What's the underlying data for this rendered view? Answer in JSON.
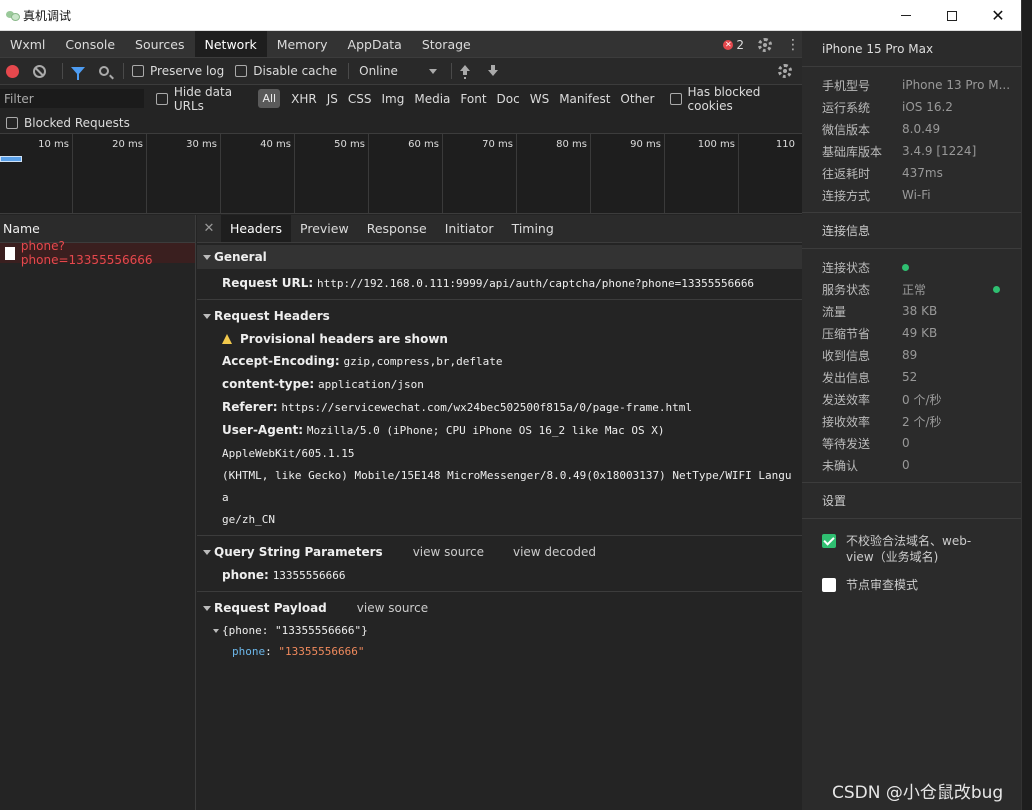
{
  "window": {
    "title": "真机调试"
  },
  "main_tabs": [
    "Wxml",
    "Console",
    "Sources",
    "Network",
    "Memory",
    "AppData",
    "Storage"
  ],
  "error_count": "2",
  "toolbar": {
    "preserve_log": "Preserve log",
    "disable_cache": "Disable cache",
    "throttle": "Online"
  },
  "filterbar": {
    "placeholder": "Filter",
    "hide_data_urls": "Hide data URLs",
    "types": [
      "All",
      "XHR",
      "JS",
      "CSS",
      "Img",
      "Media",
      "Font",
      "Doc",
      "WS",
      "Manifest",
      "Other"
    ],
    "has_blocked_cookies": "Has blocked cookies",
    "blocked_requests": "Blocked Requests"
  },
  "timeline": {
    "ticks": [
      "10 ms",
      "20 ms",
      "30 ms",
      "40 ms",
      "50 ms",
      "60 ms",
      "70 ms",
      "80 ms",
      "90 ms",
      "100 ms",
      "110"
    ]
  },
  "request_list": {
    "header": "Name",
    "items": [
      {
        "name": "phone?phone=13355556666"
      }
    ]
  },
  "detail": {
    "tabs": [
      "Headers",
      "Preview",
      "Response",
      "Initiator",
      "Timing"
    ],
    "general": {
      "title": "General",
      "request_url_label": "Request URL:",
      "request_url": "http://192.168.0.111:9999/api/auth/captcha/phone?phone=13355556666"
    },
    "request_headers": {
      "title": "Request Headers",
      "warning": "Provisional headers are shown",
      "accept_encoding_label": "Accept-Encoding:",
      "accept_encoding": "gzip,compress,br,deflate",
      "content_type_label": "content-type:",
      "content_type": "application/json",
      "referer_label": "Referer:",
      "referer": "https://servicewechat.com/wx24bec502500f815a/0/page-frame.html",
      "user_agent_label": "User-Agent:",
      "user_agent_1": "Mozilla/5.0 (iPhone; CPU iPhone OS 16_2 like Mac OS X) AppleWebKit/605.1.15",
      "user_agent_2": "(KHTML, like Gecko) Mobile/15E148 MicroMessenger/8.0.49(0x18003137) NetType/WIFI Langua",
      "user_agent_3": "ge/zh_CN"
    },
    "query": {
      "title": "Query String Parameters",
      "view_source": "view source",
      "view_decoded": "view decoded",
      "phone_label": "phone:",
      "phone_value": "13355556666"
    },
    "payload": {
      "title": "Request Payload",
      "view_source": "view source",
      "summary": "{phone: \"13355556666\"}",
      "key": "phone",
      "value": "\"13355556666\""
    }
  },
  "device_panel": {
    "device": "iPhone 15 Pro Max",
    "info": [
      {
        "label": "手机型号",
        "value": "iPhone 13 Pro M..."
      },
      {
        "label": "运行系统",
        "value": "iOS 16.2"
      },
      {
        "label": "微信版本",
        "value": "8.0.49"
      },
      {
        "label": "基础库版本",
        "value": "3.4.9 [1224]"
      },
      {
        "label": "往返耗时",
        "value": "437ms"
      },
      {
        "label": "连接方式",
        "value": "Wi-Fi"
      }
    ],
    "conn_title": "连接信息",
    "conn": [
      {
        "label": "连接状态",
        "value": ""
      },
      {
        "label": "服务状态",
        "value": "正常"
      },
      {
        "label": "流量",
        "value": "38 KB"
      },
      {
        "label": "压缩节省",
        "value": "49 KB"
      },
      {
        "label": "收到信息",
        "value": "89"
      },
      {
        "label": "发出信息",
        "value": "52"
      },
      {
        "label": "发送效率",
        "value": "0 个/秒"
      },
      {
        "label": "接收效率",
        "value": "2 个/秒"
      },
      {
        "label": "等待发送",
        "value": "0"
      },
      {
        "label": "未确认",
        "value": "0"
      }
    ],
    "settings_title": "设置",
    "settings": [
      {
        "label": "不校验合法域名、web-view（业务域名)",
        "checked": true
      },
      {
        "label": "节点审查模式",
        "checked": false
      }
    ]
  },
  "watermark": "CSDN @小仓鼠改bug"
}
